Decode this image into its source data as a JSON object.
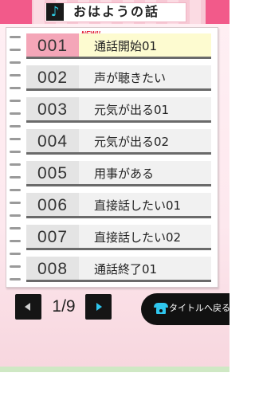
{
  "header": {
    "title": "おはようの話",
    "icon": "music-note-icon",
    "icon_glyph": "♪",
    "accent_color": "#f25a8a"
  },
  "list": {
    "new_badge": "NEW!!",
    "items": [
      {
        "number": "001",
        "label": "通話開始01",
        "selected": true
      },
      {
        "number": "002",
        "label": "声が聴きたい",
        "selected": false
      },
      {
        "number": "003",
        "label": "元気が出る01",
        "selected": false
      },
      {
        "number": "004",
        "label": "元気が出る02",
        "selected": false
      },
      {
        "number": "005",
        "label": "用事がある",
        "selected": false
      },
      {
        "number": "006",
        "label": "直接話したい01",
        "selected": false
      },
      {
        "number": "007",
        "label": "直接話したい02",
        "selected": false
      },
      {
        "number": "008",
        "label": "通話終了01",
        "selected": false
      }
    ]
  },
  "pager": {
    "current_page": "1/9",
    "prev_icon": "prev-arrow-icon",
    "next_icon": "next-arrow-icon"
  },
  "back_button": {
    "label": "タイトルへ戻る",
    "icon": "phone-icon",
    "icon_color": "#2fc6ee"
  }
}
